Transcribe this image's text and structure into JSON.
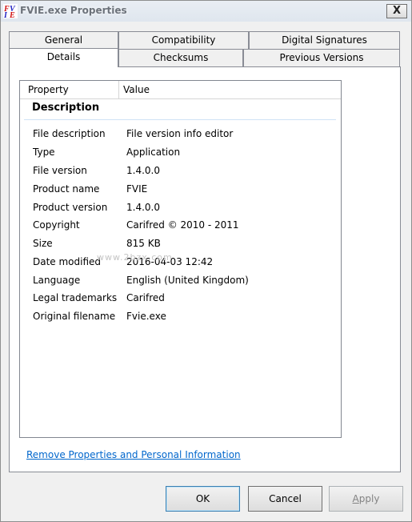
{
  "window": {
    "title": "FVIE.exe Properties",
    "close_label": "X"
  },
  "tabs": [
    {
      "label": "General",
      "active": false
    },
    {
      "label": "Compatibility",
      "active": false
    },
    {
      "label": "Digital Signatures",
      "active": false
    },
    {
      "label": "Details",
      "active": true
    },
    {
      "label": "Checksums",
      "active": false
    },
    {
      "label": "Previous Versions",
      "active": false
    }
  ],
  "details": {
    "columns": [
      "Property",
      "Value"
    ],
    "group": "Description",
    "rows": [
      {
        "property": "File description",
        "value": "File version info editor"
      },
      {
        "property": "Type",
        "value": "Application"
      },
      {
        "property": "File version",
        "value": "1.4.0.0"
      },
      {
        "property": "Product name",
        "value": "FVIE"
      },
      {
        "property": "Product version",
        "value": "1.4.0.0"
      },
      {
        "property": "Copyright",
        "value": "Carifred © 2010 - 2011"
      },
      {
        "property": "Size",
        "value": "815 KB"
      },
      {
        "property": "Date modified",
        "value": "2016-04-03 12:42"
      },
      {
        "property": "Language",
        "value": "English (United Kingdom)"
      },
      {
        "property": "Legal trademarks",
        "value": "Carifred"
      },
      {
        "property": "Original filename",
        "value": "Fvie.exe"
      }
    ]
  },
  "watermark": "www.2bzx.com",
  "remove_link": "Remove Properties and Personal Information",
  "buttons": {
    "ok": "OK",
    "cancel": "Cancel",
    "apply_first": "A",
    "apply_rest": "pply"
  },
  "colors": {
    "link": "#0066cc",
    "title_text": "#6c727a",
    "disabled_text": "#838383"
  }
}
